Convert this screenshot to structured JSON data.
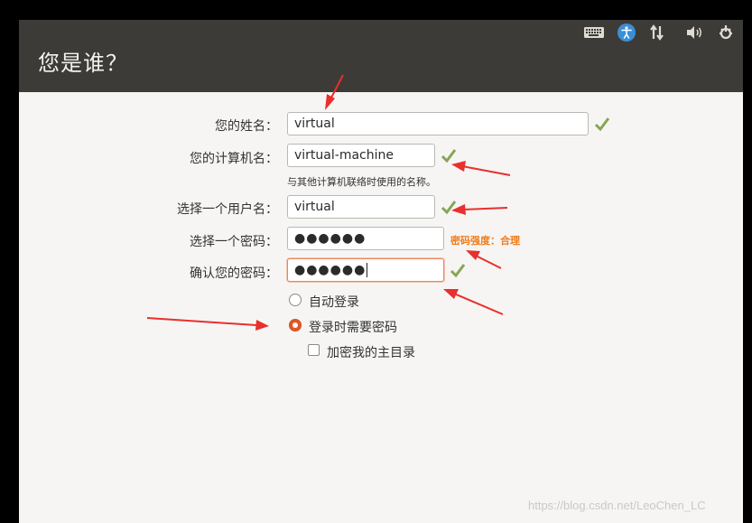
{
  "header": {
    "title": "您是谁？"
  },
  "tray": {
    "icons": [
      "keyboard-icon",
      "accessibility-icon",
      "network-icon",
      "volume-icon",
      "settings-icon"
    ]
  },
  "form": {
    "name_label": "您的姓名：",
    "name_value": "virtual",
    "computer_label": "您的计算机名：",
    "computer_value": "virtual-machine",
    "computer_hint": "与其他计算机联络时使用的名称。",
    "username_label": "选择一个用户名：",
    "username_value": "virtual",
    "password_label": "选择一个密码：",
    "password_value": "●●●●●●",
    "password_strength": "密码强度：合理",
    "confirm_label": "确认您的密码：",
    "confirm_value": "●●●●●●"
  },
  "options": {
    "auto_login": "自动登录",
    "require_password": "登录时需要密码",
    "encrypt_home": "加密我的主目录"
  },
  "watermark": "https://blog.csdn.net/LeoChen_LC",
  "colors": {
    "accent": "#e95420",
    "check": "#87a556",
    "header": "#3c3b37",
    "arrow": "#e8302c",
    "strength": "#f07c1a"
  }
}
